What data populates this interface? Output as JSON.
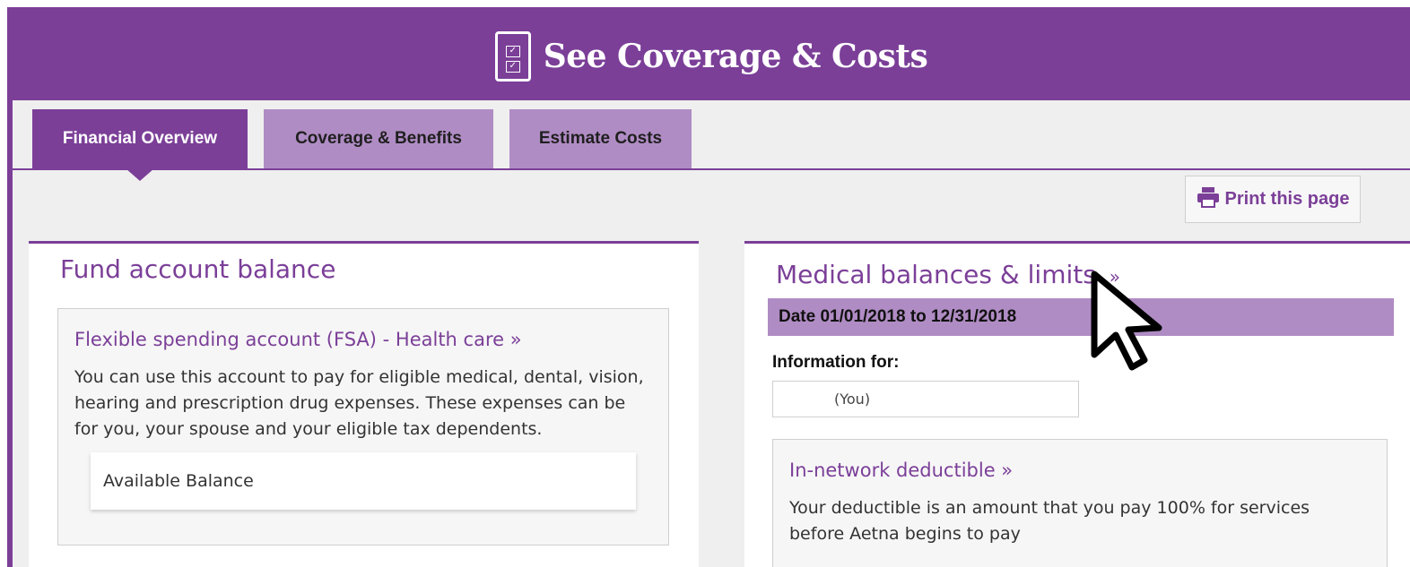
{
  "header": {
    "title": "See Coverage & Costs",
    "icon": "clipboard-check-icon"
  },
  "tabs": [
    {
      "label": "Financial Overview",
      "active": true
    },
    {
      "label": "Coverage & Benefits",
      "active": false
    },
    {
      "label": "Estimate Costs",
      "active": false
    }
  ],
  "print": {
    "label": "Print this page",
    "icon": "printer-icon"
  },
  "fund": {
    "title": "Fund account balance",
    "card": {
      "link": "Flexible spending account (FSA) - Health care  »",
      "description": "You can use this account to pay for eligible medical, dental, vision, hearing and prescription drug expenses. These expenses can be for you, your spouse and your eligible tax dependents.",
      "balance_label": "Available Balance"
    }
  },
  "medical": {
    "title": "Medical balances & limits",
    "title_suffix": "»",
    "date_range": "Date 01/01/2018 to 12/31/2018",
    "info_label": "Information for:",
    "member": "(You)",
    "deductible": {
      "link": "In-network deductible  »",
      "description": "Your deductible is an amount that you pay 100% for services before Aetna begins to pay"
    }
  },
  "colors": {
    "brand": "#7b3f98",
    "tab_inactive": "#b08cc4",
    "background": "#efefef"
  }
}
